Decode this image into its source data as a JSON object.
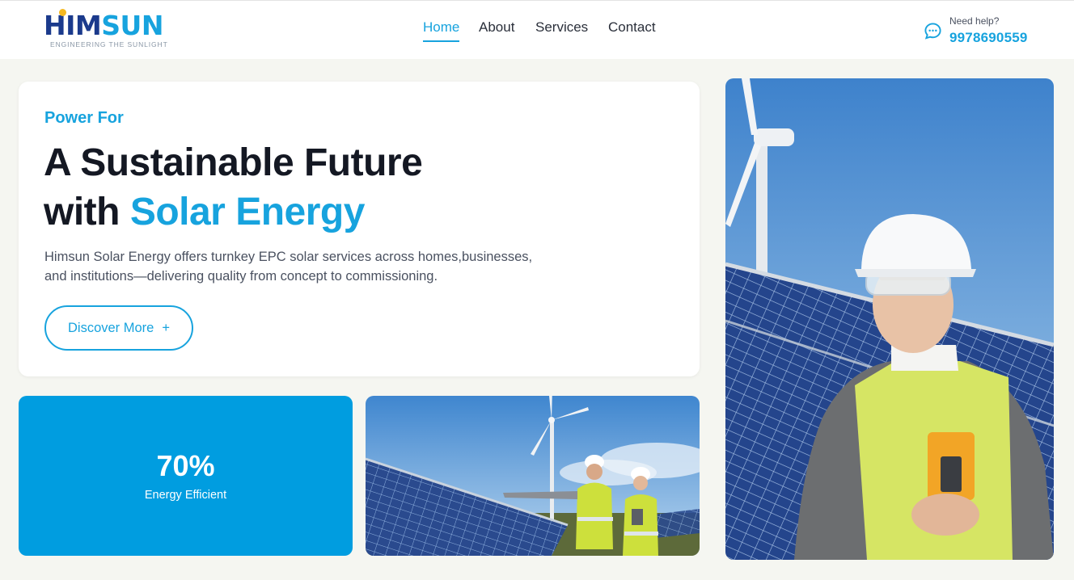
{
  "brand": {
    "name_part1": "HIM",
    "name_part2": "SUN",
    "tagline": "ENGINEERING THE SUNLIGHT"
  },
  "nav": {
    "items": [
      {
        "label": "Home",
        "active": true
      },
      {
        "label": "About",
        "active": false
      },
      {
        "label": "Services",
        "active": false
      },
      {
        "label": "Contact",
        "active": false
      }
    ]
  },
  "help": {
    "label": "Need help?",
    "phone": "9978690559",
    "icon": "chat-bubble-icon"
  },
  "hero": {
    "kicker": "Power For",
    "headline_line1": "A Sustainable Future",
    "headline_line2_prefix": "with ",
    "headline_line2_accent": "Solar Energy",
    "description_line1": "Himsun Solar Energy offers turnkey EPC solar services across homes,businesses,",
    "description_line2": "and institutions—delivering quality from concept to commissioning.",
    "cta_label": "Discover More",
    "cta_icon": "+"
  },
  "stat": {
    "value": "70%",
    "label": "Energy Efficient"
  },
  "colors": {
    "accent": "#17a3de",
    "navy": "#1b3a8c",
    "stat_bg": "#009de0",
    "page_bg": "#f5f6f1"
  }
}
